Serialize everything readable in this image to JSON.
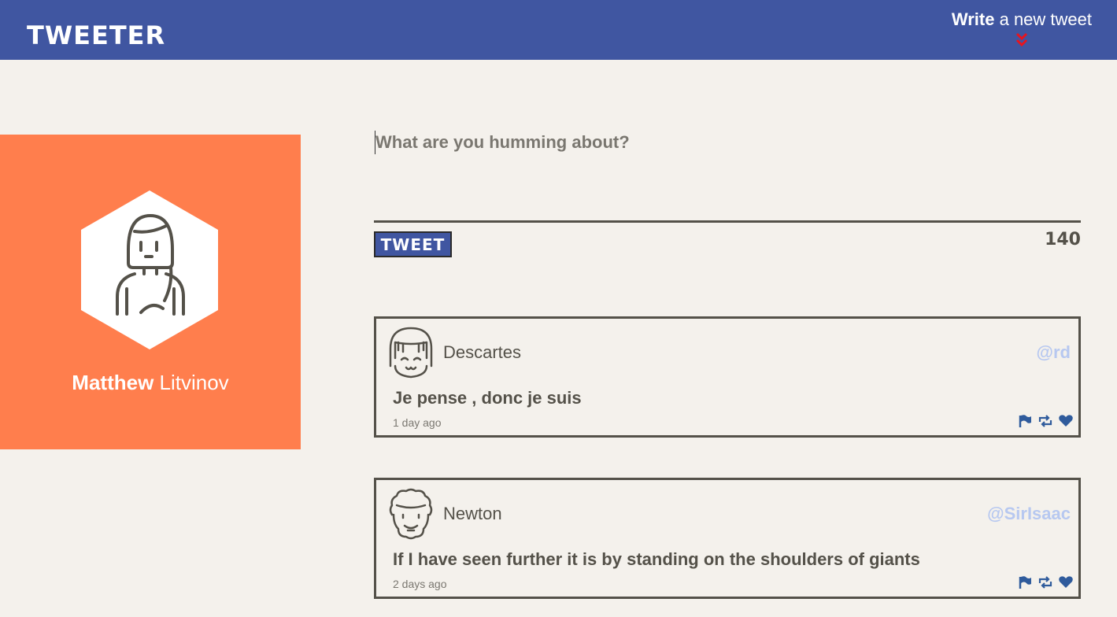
{
  "nav": {
    "brand": "TWEETER",
    "compose_bold": "Write",
    "compose_rest": " a new tweet",
    "compose_icon": "double-chevron-down-icon",
    "accent": "#4056a1",
    "chevron_color": "#e8141e"
  },
  "profile": {
    "first_name": "Matthew",
    "last_name": " Litvinov",
    "background": "#ff7e4d",
    "avatar_icon": "user-avatar-icon"
  },
  "composer": {
    "placeholder": "What are you humming about?",
    "value": "",
    "submit_label": "TWEET",
    "counter": "140"
  },
  "tweets": [
    {
      "name": "Descartes",
      "handle": "@rd",
      "content": "Je pense , donc je suis",
      "time": "1 day ago",
      "avatar_icon": "descartes-avatar-icon",
      "actions": [
        "flag-icon",
        "retweet-icon",
        "heart-icon"
      ]
    },
    {
      "name": "Newton",
      "handle": "@SirIsaac",
      "content": "If I have seen further it is by standing on the shoulders of giants",
      "time": "2 days ago",
      "avatar_icon": "newton-avatar-icon",
      "actions": [
        "flag-icon",
        "retweet-icon",
        "heart-icon"
      ]
    }
  ]
}
